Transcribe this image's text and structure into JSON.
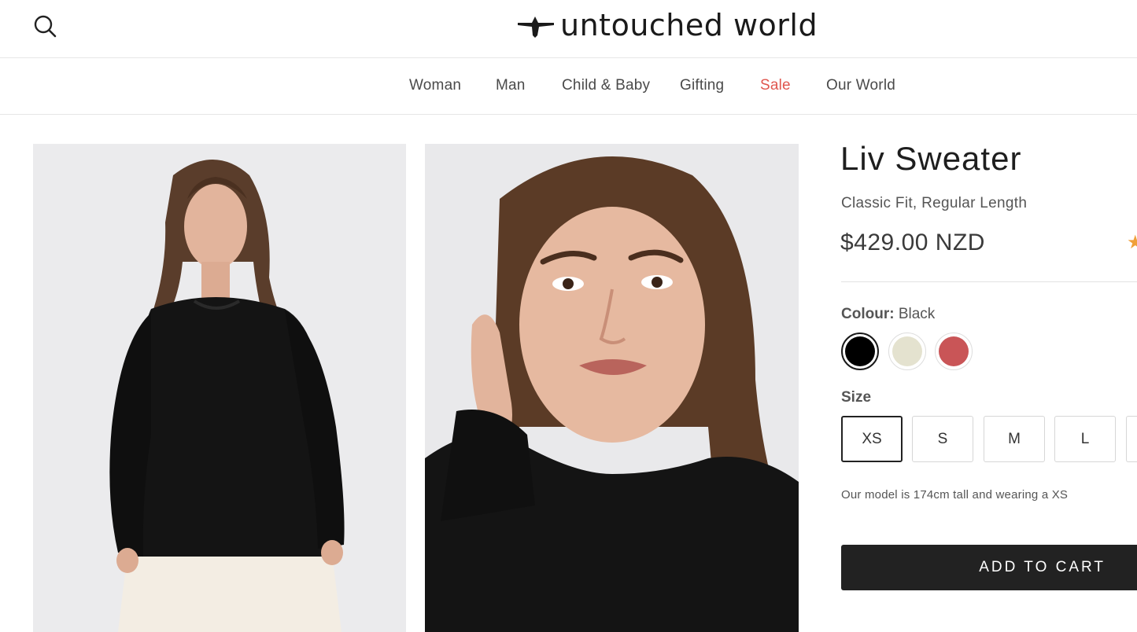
{
  "header": {
    "logo_text": "untouched world",
    "icons": {
      "search": "search-icon",
      "logo": "bird-logo-icon"
    }
  },
  "nav": {
    "items": [
      {
        "label": "Woman"
      },
      {
        "label": "Man"
      },
      {
        "label": "Child & Baby"
      },
      {
        "label": "Gifting"
      },
      {
        "label": "Sale"
      },
      {
        "label": "Our World"
      }
    ]
  },
  "gallery": {
    "images": [
      "product-photo-full-body",
      "product-photo-close-up"
    ]
  },
  "product": {
    "title": "Liv Sweater",
    "subtitle": "Classic Fit, Regular Length",
    "price": "$429.00 NZD",
    "colour_label": "Colour:",
    "colour_value": "Black",
    "swatches": [
      {
        "color": "#000000",
        "selected": true
      },
      {
        "color": "#e4e2cf",
        "selected": false
      },
      {
        "color": "#c95557",
        "selected": false
      }
    ],
    "size_label": "Size",
    "sizes": [
      "XS",
      "S",
      "M",
      "L"
    ],
    "selected_size": "XS",
    "model_note": "Our model is 174cm tall and wearing a XS",
    "add_to_cart": "ADD TO CART"
  },
  "colors": {
    "accent_sale": "#e0574f",
    "rating_star": "#f0a03a",
    "button_bg": "#222222"
  }
}
